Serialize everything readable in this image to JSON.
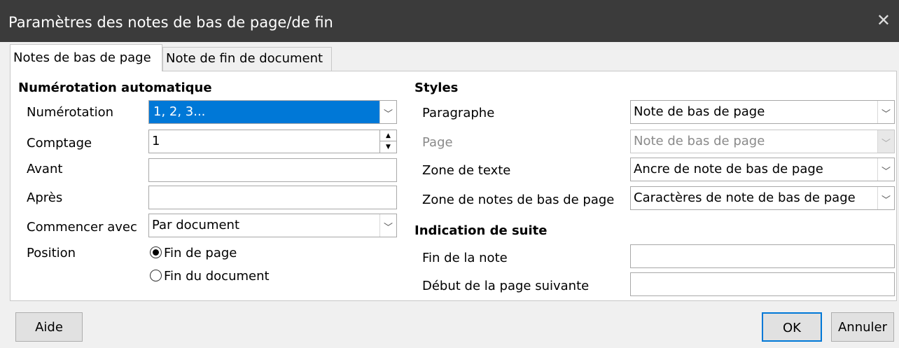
{
  "window": {
    "title": "Paramètres des notes de bas de page/de fin",
    "close_icon": "close-icon"
  },
  "tabs": [
    {
      "label": "Notes de bas de page"
    },
    {
      "label": "Note de fin de document"
    }
  ],
  "auto_numbering": {
    "heading": "Numérotation automatique",
    "numbering": {
      "label": "Numérotation",
      "value": "1, 2, 3..."
    },
    "counting": {
      "label": "Comptage",
      "value": "1"
    },
    "before": {
      "label": "Avant",
      "value": ""
    },
    "after": {
      "label": "Après",
      "value": ""
    },
    "start_with": {
      "label": "Commencer avec",
      "value": "Par document"
    },
    "position": {
      "label": "Position",
      "options": [
        {
          "label": "Fin de page",
          "selected": true
        },
        {
          "label": "Fin du document",
          "selected": false
        }
      ]
    }
  },
  "styles": {
    "heading": "Styles",
    "paragraph": {
      "label": "Paragraphe",
      "value": "Note de bas de page"
    },
    "page": {
      "label": "Page",
      "value": "Note de bas de page"
    },
    "text_area": {
      "label": "Zone de texte",
      "value": "Ancre de note de bas de page"
    },
    "footnote_area": {
      "label": "Zone de notes de bas de page",
      "value": "Caractères de note de bas de page"
    }
  },
  "continuation": {
    "heading": "Indication de suite",
    "end_of_note": {
      "label": "Fin de la note",
      "value": ""
    },
    "start_next_page": {
      "label": "Début de la page suivante",
      "value": ""
    }
  },
  "buttons": {
    "help": "Aide",
    "ok": "OK",
    "cancel": "Annuler"
  }
}
